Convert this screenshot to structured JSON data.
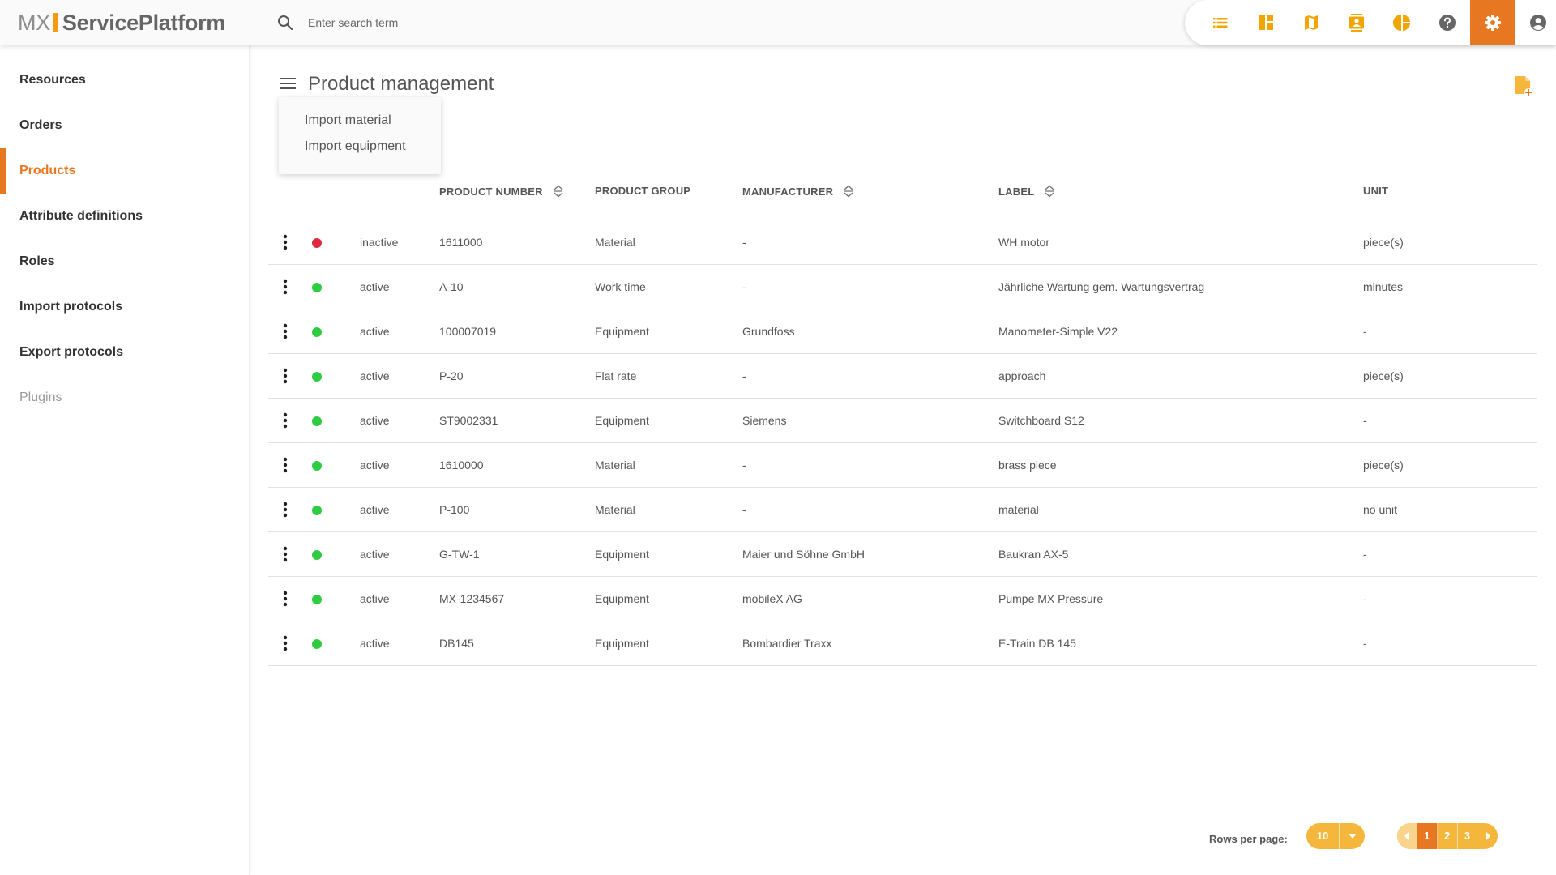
{
  "app": {
    "logo_left": "MX",
    "logo_right": "ServicePlatform"
  },
  "search": {
    "placeholder": "Enter search term"
  },
  "colors": {
    "accent": "#e87722",
    "accent_light": "#f5b73b",
    "status_active": "#2ecc40",
    "status_inactive": "#e02a3b"
  },
  "toolbar": {
    "items": [
      {
        "icon": "list-icon"
      },
      {
        "icon": "dashboard-icon"
      },
      {
        "icon": "map-icon"
      },
      {
        "icon": "contacts-icon"
      },
      {
        "icon": "pie-chart-icon"
      },
      {
        "icon": "help-icon"
      },
      {
        "icon": "settings-icon",
        "active": true
      },
      {
        "icon": "account-icon"
      }
    ]
  },
  "sidebar": {
    "items": [
      {
        "label": "Resources"
      },
      {
        "label": "Orders"
      },
      {
        "label": "Products",
        "active": true
      },
      {
        "label": "Attribute definitions"
      },
      {
        "label": "Roles"
      },
      {
        "label": "Import protocols"
      },
      {
        "label": "Export protocols"
      },
      {
        "label": "Plugins",
        "disabled": true
      }
    ]
  },
  "page": {
    "title": "Product management"
  },
  "menu": {
    "items": [
      "Import material",
      "Import equipment"
    ]
  },
  "table": {
    "columns": [
      {
        "label": "PRODUCT NUMBER",
        "sortable": true
      },
      {
        "label": "PRODUCT GROUP",
        "sortable": false
      },
      {
        "label": "MANUFACTURER",
        "sortable": true
      },
      {
        "label": "LABEL",
        "sortable": true
      },
      {
        "label": "UNIT",
        "sortable": false
      }
    ],
    "rows": [
      {
        "status": "inactive",
        "number": "1611000",
        "group": "Material",
        "manufacturer": "-",
        "label": "WH motor",
        "unit": "piece(s)"
      },
      {
        "status": "active",
        "number": "A-10",
        "group": "Work time",
        "manufacturer": "-",
        "label": "Jährliche Wartung gem. Wartungsvertrag",
        "unit": "minutes"
      },
      {
        "status": "active",
        "number": "100007019",
        "group": "Equipment",
        "manufacturer": "Grundfoss",
        "label": "Manometer-Simple V22",
        "unit": "-"
      },
      {
        "status": "active",
        "number": "P-20",
        "group": "Flat rate",
        "manufacturer": "-",
        "label": "approach",
        "unit": "piece(s)"
      },
      {
        "status": "active",
        "number": "ST9002331",
        "group": "Equipment",
        "manufacturer": "Siemens",
        "label": "Switchboard S12",
        "unit": "-"
      },
      {
        "status": "active",
        "number": "1610000",
        "group": "Material",
        "manufacturer": "-",
        "label": "brass piece",
        "unit": "piece(s)"
      },
      {
        "status": "active",
        "number": "P-100",
        "group": "Material",
        "manufacturer": "-",
        "label": "material",
        "unit": "no unit"
      },
      {
        "status": "active",
        "number": "G-TW-1",
        "group": "Equipment",
        "manufacturer": "Maier und Söhne GmbH",
        "label": "Baukran AX-5",
        "unit": "-"
      },
      {
        "status": "active",
        "number": "MX-1234567",
        "group": "Equipment",
        "manufacturer": "mobileX AG",
        "label": "Pumpe MX Pressure",
        "unit": "-"
      },
      {
        "status": "active",
        "number": "DB145",
        "group": "Equipment",
        "manufacturer": "Bombardier Traxx",
        "label": "E-Train DB 145",
        "unit": "-"
      }
    ]
  },
  "pagination": {
    "rows_per_page_label": "Rows per page:",
    "rows_per_page_value": "10",
    "pages": [
      "1",
      "2",
      "3"
    ],
    "current_page": "1"
  }
}
